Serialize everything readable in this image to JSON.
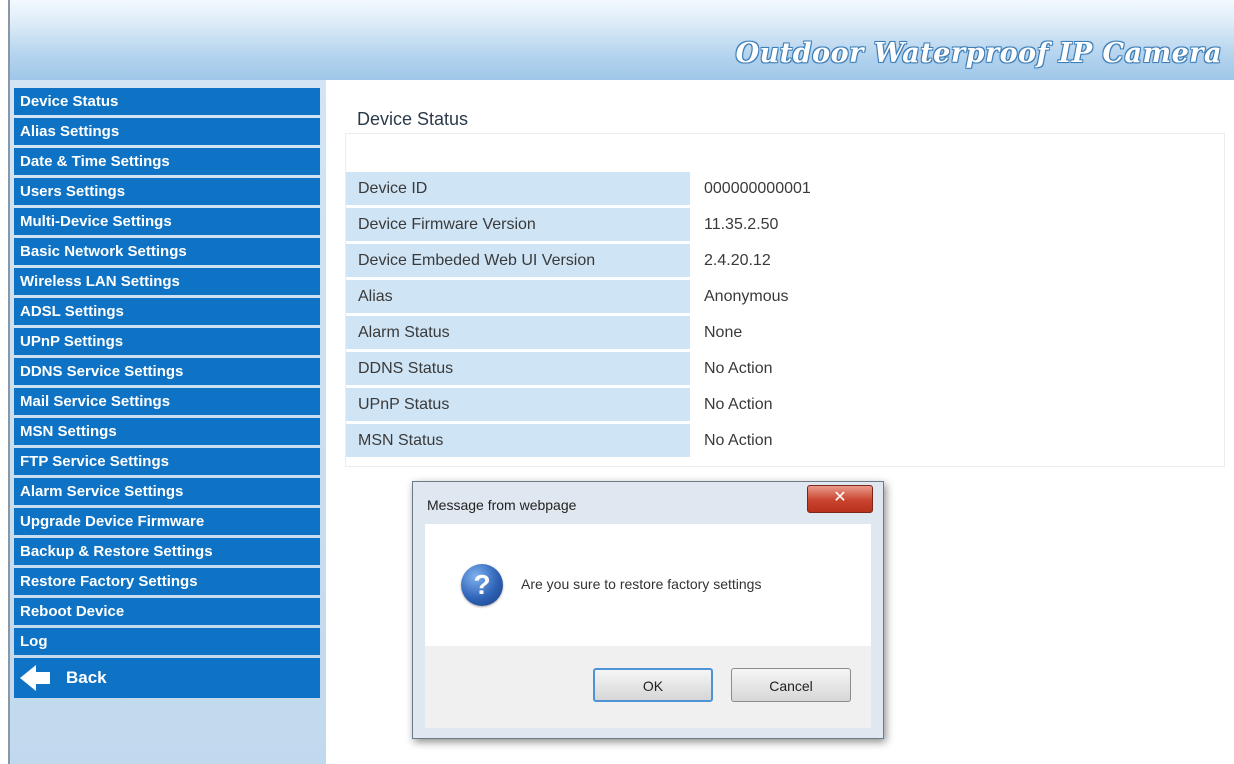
{
  "header": {
    "title": "Outdoor Waterproof IP Camera"
  },
  "sidebar": {
    "items": [
      {
        "label": "Device Status"
      },
      {
        "label": "Alias Settings"
      },
      {
        "label": "Date & Time Settings"
      },
      {
        "label": "Users Settings"
      },
      {
        "label": "Multi-Device Settings"
      },
      {
        "label": "Basic Network Settings"
      },
      {
        "label": "Wireless LAN Settings"
      },
      {
        "label": "ADSL Settings"
      },
      {
        "label": "UPnP Settings"
      },
      {
        "label": "DDNS Service Settings"
      },
      {
        "label": "Mail Service Settings"
      },
      {
        "label": "MSN Settings"
      },
      {
        "label": "FTP Service Settings"
      },
      {
        "label": "Alarm Service Settings"
      },
      {
        "label": "Upgrade Device Firmware"
      },
      {
        "label": "Backup & Restore Settings"
      },
      {
        "label": "Restore Factory Settings"
      },
      {
        "label": "Reboot Device"
      },
      {
        "label": "Log"
      }
    ],
    "back_label": "Back"
  },
  "main": {
    "title": "Device Status",
    "rows": [
      {
        "label": "Device ID",
        "value": "000000000001"
      },
      {
        "label": "Device Firmware Version",
        "value": "11.35.2.50"
      },
      {
        "label": "Device Embeded Web UI Version",
        "value": "2.4.20.12"
      },
      {
        "label": "Alias",
        "value": "Anonymous"
      },
      {
        "label": "Alarm Status",
        "value": "None"
      },
      {
        "label": "DDNS Status",
        "value": "No Action"
      },
      {
        "label": "UPnP Status",
        "value": "No Action"
      },
      {
        "label": "MSN Status",
        "value": "No Action"
      }
    ]
  },
  "dialog": {
    "title": "Message from webpage",
    "close_label": "✕",
    "icon_glyph": "?",
    "message": "Are you sure to restore factory settings",
    "ok_label": "OK",
    "cancel_label": "Cancel"
  }
}
